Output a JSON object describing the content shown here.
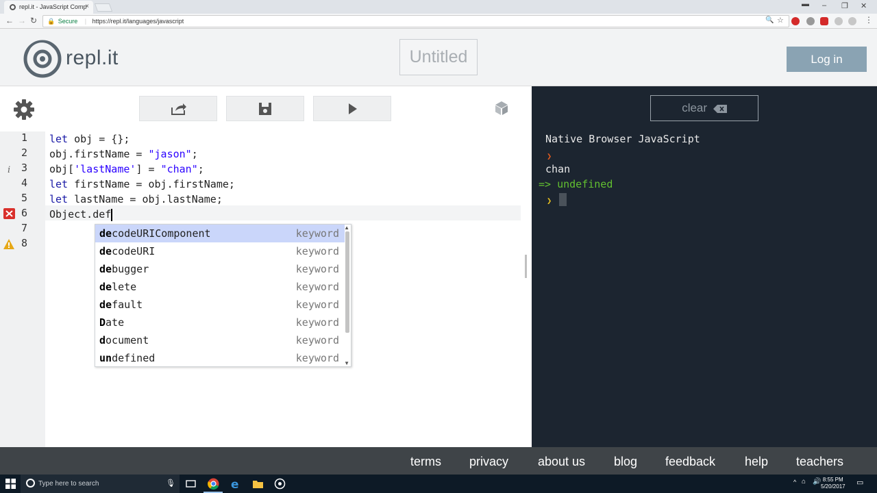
{
  "browser": {
    "tab_title": "repl.it - JavaScript Comp",
    "close_glyph": "×",
    "url_secure_label": "Secure",
    "url": "https://repl.it/languages/javascript"
  },
  "header": {
    "logo_text": "repl.it",
    "project_title": "Untitled",
    "login_label": "Log in"
  },
  "editor": {
    "line_numbers": [
      "1",
      "2",
      "3",
      "4",
      "5",
      "6",
      "7",
      "8"
    ],
    "lines": [
      "let obj = {};",
      "obj.firstName = \"jason\";",
      "obj['lastName'] = \"chan\";",
      "let firstName = obj.firstName;",
      "let lastName = obj.lastName;",
      "Object.def",
      "",
      ""
    ],
    "gutter_markers": {
      "line3": "info-icon",
      "line6": "error-icon",
      "line8": "warning-icon"
    }
  },
  "autocomplete": {
    "items": [
      {
        "match": "de",
        "rest": "codeURIComponent",
        "kind": "keyword"
      },
      {
        "match": "de",
        "rest": "codeURI",
        "kind": "keyword"
      },
      {
        "match": "de",
        "rest": "bugger",
        "kind": "keyword"
      },
      {
        "match": "de",
        "rest": "lete",
        "kind": "keyword"
      },
      {
        "match": "de",
        "rest": "fault",
        "kind": "keyword"
      },
      {
        "match": "D",
        "rest": "ate",
        "kind": "keyword"
      },
      {
        "match": "d",
        "rest": "ocument",
        "kind": "keyword"
      },
      {
        "match": "un",
        "rest": "defined",
        "kind": "keyword"
      }
    ],
    "selected_index": 0
  },
  "console": {
    "clear_label": "clear",
    "banner": "Native Browser JavaScript",
    "output": "chan",
    "result_prefix": "=>",
    "result_value": "undefined"
  },
  "footer": {
    "links": [
      "terms",
      "privacy",
      "about us",
      "blog",
      "feedback",
      "help",
      "teachers"
    ]
  },
  "taskbar": {
    "search_placeholder": "Type here to search",
    "time": "8:55 PM",
    "date": "5/20/2017"
  },
  "colors": {
    "console_bg": "#1c2530",
    "login_button": "#8aa3b3",
    "footer_bg": "#3f4448",
    "result_green": "#62c030",
    "selection": "#cad6fa"
  }
}
